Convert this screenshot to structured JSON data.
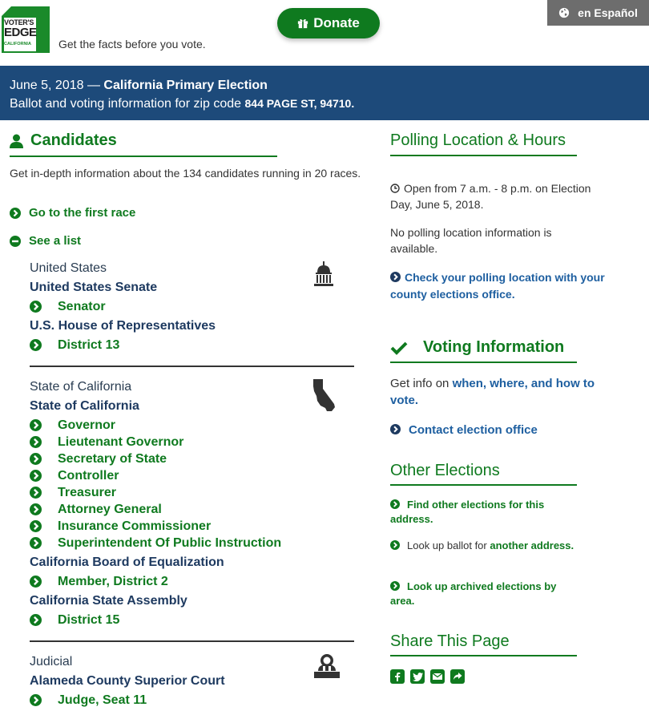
{
  "header": {
    "logo": {
      "line1": "VOTER'S",
      "line2": "EDGE",
      "line3": "CALIFORNIA"
    },
    "tagline": "Get the facts before you vote.",
    "donate_label": "Donate",
    "language_label": "en Español"
  },
  "banner": {
    "date": "June 5, 2018 — ",
    "election": "California Primary Election",
    "zip_prefix": "Ballot and voting information for zip code ",
    "address": "844 PAGE ST, 94710."
  },
  "candidates": {
    "title": "Candidates",
    "intro": "Get in-depth information about the 134 candidates running in 20 races.",
    "first_race_label": "Go to the first race",
    "see_list_label": "See a list",
    "groups": [
      {
        "label": "United States",
        "icon": "capitol-icon",
        "offices": [
          {
            "name": "United States Senate",
            "races": [
              "Senator"
            ]
          },
          {
            "name": "U.S. House of Representatives",
            "races": [
              "District 13"
            ]
          }
        ]
      },
      {
        "label": "State of California",
        "icon": "california-icon",
        "offices": [
          {
            "name": "State of California",
            "races": [
              "Governor",
              "Lieutenant Governor",
              "Secretary of State",
              "Controller",
              "Treasurer",
              "Attorney General",
              "Insurance Commissioner",
              "Superintendent Of Public Instruction"
            ]
          },
          {
            "name": "California Board of Equalization",
            "races": [
              "Member, District 2"
            ]
          },
          {
            "name": "California State Assembly",
            "races": [
              "District 15"
            ]
          }
        ]
      },
      {
        "label": "Judicial",
        "icon": "judge-icon",
        "offices": [
          {
            "name": "Alameda County Superior Court",
            "races": [
              "Judge, Seat 11"
            ]
          }
        ]
      }
    ]
  },
  "polling": {
    "title": "Polling Location & Hours",
    "hours": "Open from 7 a.m. - 8 p.m. on Election Day, June 5, 2018.",
    "no_info": "No polling location information is available.",
    "check_link": "Check your polling location with your county elections office."
  },
  "voting_info": {
    "title": "Voting Information",
    "get_info_prefix": "Get info on ",
    "get_info_link": "when, where, and how to vote.",
    "contact_link": "Contact election office"
  },
  "other_elections": {
    "title": "Other Elections",
    "find_link": "Find other elections for this address.",
    "lookup_prefix": "Look up ballot for ",
    "lookup_link": "another address.",
    "archived_link": "Look up archived elections by area."
  },
  "share": {
    "title": "Share This Page",
    "icons": [
      "facebook-icon",
      "twitter-icon",
      "email-icon",
      "share-icon"
    ]
  },
  "colors": {
    "green": "#0f7a1f",
    "navy": "#1d4a7a",
    "link_blue": "#1e5fa0",
    "gray_button": "#6d6d6d"
  }
}
